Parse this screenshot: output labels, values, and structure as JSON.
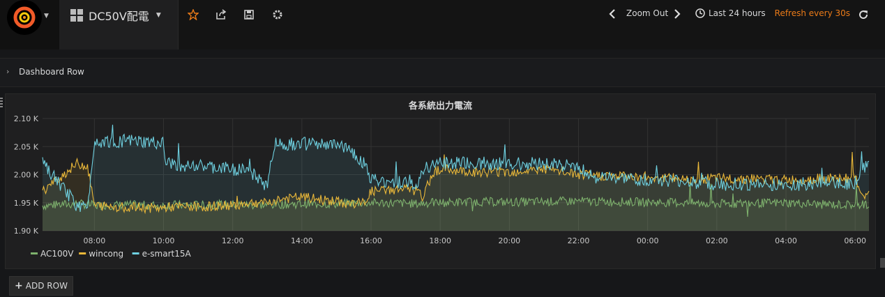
{
  "nav": {
    "dashboard_title": "DC50V配電",
    "zoom_out": "Zoom Out",
    "time_range": "Last 24 hours",
    "refresh": "Refresh every 30s"
  },
  "row": {
    "title": "Dashboard Row"
  },
  "add_row": {
    "label": "ADD ROW"
  },
  "chart_data": {
    "type": "line",
    "title": "各系統出力電流",
    "y_ticks": [
      "2.10 K",
      "2.05 K",
      "2.00 K",
      "1.95 K",
      "1.90 K"
    ],
    "x_ticks": [
      "08:00",
      "10:00",
      "12:00",
      "14:00",
      "16:00",
      "18:00",
      "20:00",
      "22:00",
      "00:00",
      "02:00",
      "04:00",
      "06:00"
    ],
    "ylim": [
      1900,
      2100
    ],
    "grid": true,
    "legend_position": "bottom-left",
    "x_hours": [
      6.5,
      7.5,
      7.8,
      8.0,
      9.0,
      10.0,
      10.05,
      11.0,
      12.0,
      12.4,
      13.0,
      13.2,
      14.0,
      15.0,
      15.3,
      15.8,
      16.0,
      17.0,
      17.3,
      17.5,
      17.8,
      18.0,
      19.0,
      20.0,
      21.0,
      22.0,
      22.5,
      23.0,
      24.0,
      25.0,
      26.0,
      27.0,
      28.0,
      29.0,
      30.0,
      30.2,
      30.4
    ],
    "series": [
      {
        "name": "AC100V",
        "color": "#7eb26d",
        "values": [
          1945,
          1948,
          1947,
          1945,
          1946,
          1945,
          1946,
          1946,
          1947,
          1946,
          1946,
          1947,
          1948,
          1948,
          1949,
          1950,
          1950,
          1949,
          1948,
          1949,
          1950,
          1950,
          1952,
          1951,
          1952,
          1953,
          1952,
          1952,
          1951,
          1950,
          1948,
          1949,
          1950,
          1947,
          1946,
          1947,
          1946
        ]
      },
      {
        "name": "wincong",
        "color": "#eab839",
        "values": [
          1970,
          2020,
          2015,
          1945,
          1942,
          1940,
          1942,
          1943,
          1945,
          1950,
          1950,
          1955,
          1960,
          1952,
          1948,
          1950,
          1970,
          1975,
          1970,
          1960,
          2005,
          2010,
          2005,
          2005,
          2010,
          2000,
          1998,
          1998,
          1996,
          1993,
          1993,
          1993,
          1990,
          1993,
          1995,
          1965,
          1960
        ]
      },
      {
        "name": "e-smart15A",
        "color": "#6ed0e0",
        "values": [
          2020,
          1945,
          1940,
          2060,
          2060,
          2055,
          2020,
          2015,
          2010,
          2010,
          1980,
          2055,
          2055,
          2052,
          2050,
          2020,
          1990,
          1985,
          1980,
          2010,
          2020,
          2020,
          2020,
          2020,
          2020,
          2015,
          1995,
          1993,
          1990,
          1988,
          1983,
          1983,
          1982,
          1985,
          1985,
          2010,
          2020
        ]
      }
    ]
  }
}
